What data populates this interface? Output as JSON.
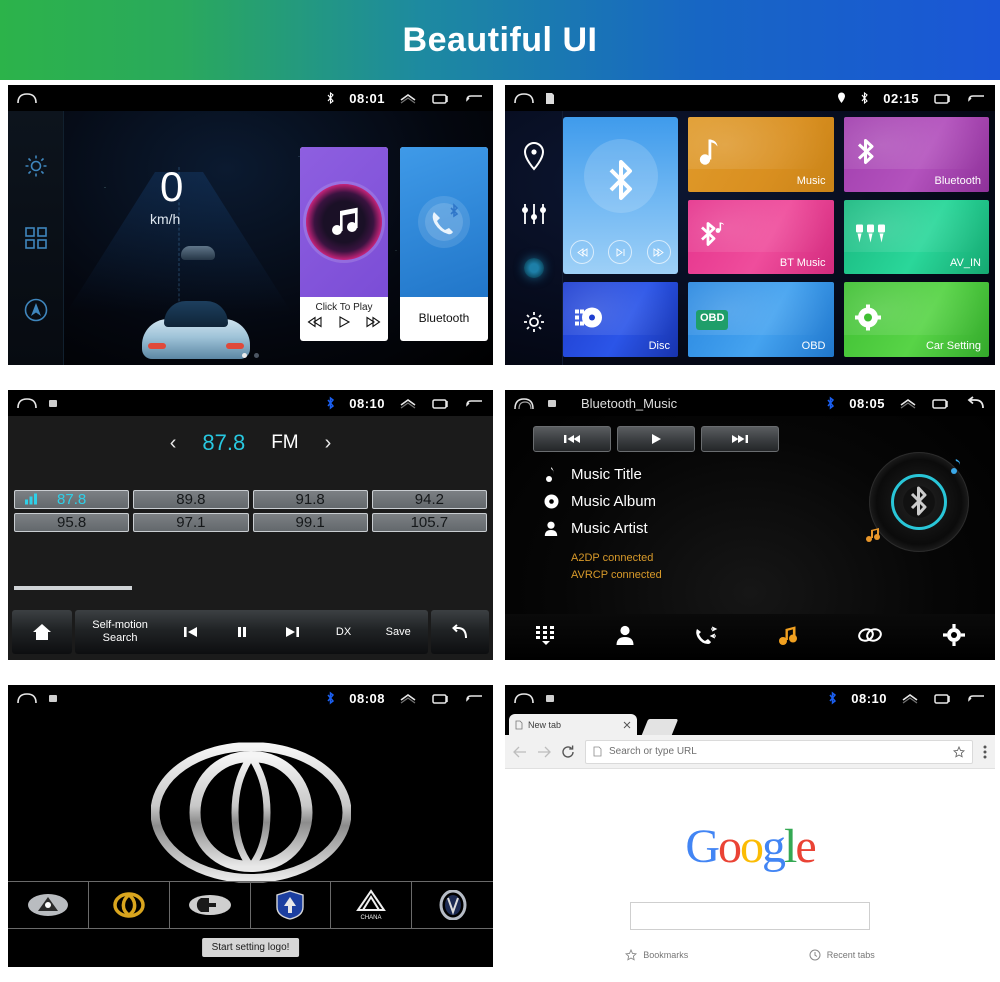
{
  "banner": {
    "title": "Beautiful UI"
  },
  "panels": {
    "home": {
      "status": {
        "time": "08:01",
        "bluetooth_icon": "bluetooth-icon",
        "home_icon": "home-icon",
        "expand_icon": "chevron-up-icon",
        "recents_icon": "recents-icon",
        "back_icon": "back-icon"
      },
      "rail": [
        {
          "name": "settings",
          "icon": "gear-icon"
        },
        {
          "name": "apps",
          "icon": "grid-icon"
        },
        {
          "name": "navigation",
          "icon": "navigation-icon"
        }
      ],
      "speed": {
        "value": "0",
        "unit": "km/h"
      },
      "music_card": {
        "label": "Click To Play",
        "prev": "prev-icon",
        "play": "play-icon",
        "next": "next-icon"
      },
      "bluetooth_card": {
        "label": "Bluetooth"
      },
      "page_dots": 2
    },
    "apps": {
      "status": {
        "time": "02:15",
        "sd_icon": "sd-card-icon",
        "location_icon": "location-icon",
        "bluetooth_icon": "bluetooth-icon"
      },
      "rail": [
        {
          "name": "location",
          "icon": "location-pin-icon"
        },
        {
          "name": "equalizer",
          "icon": "equalizer-icon"
        },
        {
          "name": "indicator",
          "icon": "dot-indicator"
        },
        {
          "name": "settings",
          "icon": "gear-icon"
        }
      ],
      "bt_widget": {
        "prev": "prev-icon",
        "play": "play-pause-icon",
        "next": "next-icon"
      },
      "tiles": [
        {
          "label": "Music",
          "icon": "music-note-icon",
          "color": "#d98f20"
        },
        {
          "label": "Bluetooth",
          "icon": "bluetooth-icon",
          "color": "#a13fae"
        },
        {
          "label": "BT Music",
          "icon": "bluetooth-music-icon",
          "color": "#e5338c"
        },
        {
          "label": "AV_IN",
          "icon": "av-in-icon",
          "color": "#19b87f"
        },
        {
          "label": "Disc",
          "icon": "disc-icon",
          "color": "#1f3fd0"
        },
        {
          "label": "OBD",
          "icon": "obd-icon",
          "color": "#2a88e0",
          "badge": "OBD"
        },
        {
          "label": "Car Setting",
          "icon": "gear-icon",
          "color": "#3fbf33"
        }
      ]
    },
    "radio": {
      "status": {
        "time": "08:10",
        "bluetooth_icon": "bluetooth-icon",
        "sd_icon": "sd-card-icon"
      },
      "frequency": {
        "value": "87.8",
        "band": "FM",
        "prev_arrow": "‹",
        "next_arrow": "›"
      },
      "presets": [
        "87.8",
        "89.8",
        "91.8",
        "94.2",
        "95.8",
        "97.1",
        "99.1",
        "105.7"
      ],
      "active_preset_index": 0,
      "toolbar": {
        "home": "home-icon",
        "search_label": "Self-motion\nSearch",
        "search_line1": "Self-motion",
        "search_line2": "Search",
        "prev": "prev-icon",
        "pause": "pause-icon",
        "next": "next-icon",
        "dx_label": "DX",
        "save_label": "Save",
        "back": "back-icon"
      }
    },
    "btmusic": {
      "status": {
        "title": "Bluetooth_Music",
        "time": "08:05",
        "bluetooth_icon": "bluetooth-icon"
      },
      "transport": {
        "prev": "prev-icon",
        "play": "play-icon",
        "next": "next-icon"
      },
      "meta": [
        {
          "label": "Music Title",
          "icon": "note-icon"
        },
        {
          "label": "Music Album",
          "icon": "album-icon"
        },
        {
          "label": "Music Artist",
          "icon": "person-icon"
        }
      ],
      "status_lines": [
        "A2DP connected",
        "AVRCP connected"
      ],
      "status_color": "#d89a2a",
      "navbar": [
        {
          "name": "dialpad",
          "icon": "dialpad-icon",
          "active": false
        },
        {
          "name": "contacts",
          "icon": "contacts-icon",
          "active": false
        },
        {
          "name": "call-history",
          "icon": "call-history-icon",
          "active": false
        },
        {
          "name": "music",
          "icon": "music-note-icon",
          "active": true
        },
        {
          "name": "pair",
          "icon": "link-icon",
          "active": false
        },
        {
          "name": "settings",
          "icon": "gear-icon",
          "active": false
        }
      ]
    },
    "logo": {
      "status": {
        "time": "08:08",
        "bluetooth_icon": "bluetooth-icon",
        "sd_icon": "sd-card-icon"
      },
      "main_logo": "baojun-logo",
      "brands": [
        "changhe-logo",
        "baojun-logo",
        "haval-logo",
        "shield-logo",
        "chana-logo",
        "changan-logo"
      ],
      "brand_caption": "CHANA",
      "toast": "Start setting logo!"
    },
    "browser": {
      "status": {
        "time": "08:10",
        "bluetooth_icon": "bluetooth-icon",
        "sd_icon": "sd-card-icon"
      },
      "tab": {
        "title": "New tab",
        "close_icon": "close-icon",
        "page_icon": "page-icon"
      },
      "omnibox": {
        "placeholder": "Search or type URL",
        "back_icon": "back-arrow-icon",
        "forward_icon": "forward-arrow-icon",
        "reload_icon": "reload-icon",
        "star_icon": "star-icon",
        "menu_icon": "more-vert-icon"
      },
      "google": {
        "letters": [
          "G",
          "o",
          "o",
          "g",
          "l",
          "e"
        ]
      },
      "footer": [
        {
          "label": "Bookmarks",
          "icon": "star-icon"
        },
        {
          "label": "Recent tabs",
          "icon": "clock-icon"
        }
      ]
    }
  }
}
